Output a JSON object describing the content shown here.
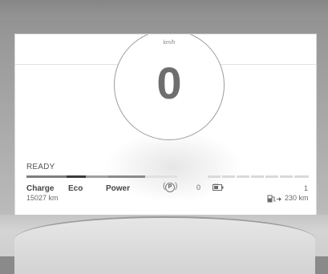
{
  "speedometer": {
    "unit": "km/h",
    "speed": "0"
  },
  "status": {
    "ready": "READY"
  },
  "power_scale": {
    "charge_label": "Charge",
    "eco_label": "Eco",
    "power_label": "Power"
  },
  "drive": {
    "park_symbol": "P",
    "gear_value": "0"
  },
  "trip": {
    "odometer": "15027 km",
    "right_value": "1",
    "range": "230 km"
  },
  "colors": {
    "segment_dark": "#3b3b3b",
    "segment_mid": "#7a7a7a",
    "segment_light": "#d9d9d9"
  },
  "icons": {
    "battery": "battery-plug-icon",
    "fuel": "fuel-pump-icon"
  }
}
